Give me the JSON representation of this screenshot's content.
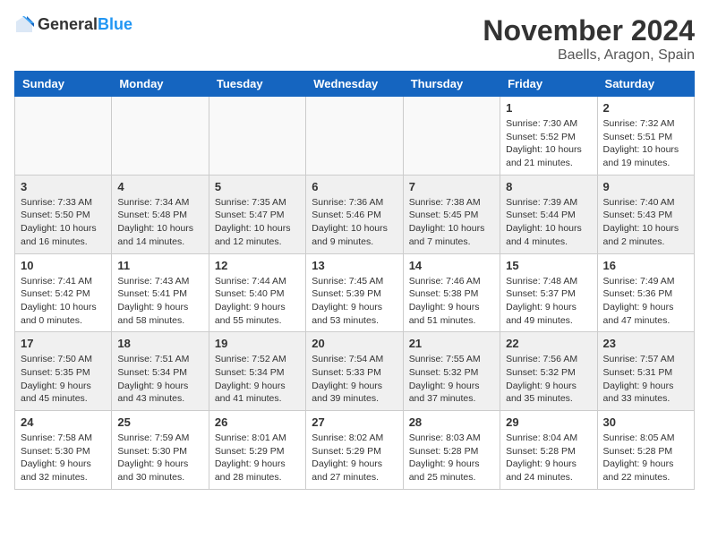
{
  "header": {
    "logo_general": "General",
    "logo_blue": "Blue",
    "month_title": "November 2024",
    "location": "Baells, Aragon, Spain"
  },
  "weekdays": [
    "Sunday",
    "Monday",
    "Tuesday",
    "Wednesday",
    "Thursday",
    "Friday",
    "Saturday"
  ],
  "weeks": [
    [
      {
        "day": "",
        "info": ""
      },
      {
        "day": "",
        "info": ""
      },
      {
        "day": "",
        "info": ""
      },
      {
        "day": "",
        "info": ""
      },
      {
        "day": "",
        "info": ""
      },
      {
        "day": "1",
        "info": "Sunrise: 7:30 AM\nSunset: 5:52 PM\nDaylight: 10 hours and 21 minutes."
      },
      {
        "day": "2",
        "info": "Sunrise: 7:32 AM\nSunset: 5:51 PM\nDaylight: 10 hours and 19 minutes."
      }
    ],
    [
      {
        "day": "3",
        "info": "Sunrise: 7:33 AM\nSunset: 5:50 PM\nDaylight: 10 hours and 16 minutes."
      },
      {
        "day": "4",
        "info": "Sunrise: 7:34 AM\nSunset: 5:48 PM\nDaylight: 10 hours and 14 minutes."
      },
      {
        "day": "5",
        "info": "Sunrise: 7:35 AM\nSunset: 5:47 PM\nDaylight: 10 hours and 12 minutes."
      },
      {
        "day": "6",
        "info": "Sunrise: 7:36 AM\nSunset: 5:46 PM\nDaylight: 10 hours and 9 minutes."
      },
      {
        "day": "7",
        "info": "Sunrise: 7:38 AM\nSunset: 5:45 PM\nDaylight: 10 hours and 7 minutes."
      },
      {
        "day": "8",
        "info": "Sunrise: 7:39 AM\nSunset: 5:44 PM\nDaylight: 10 hours and 4 minutes."
      },
      {
        "day": "9",
        "info": "Sunrise: 7:40 AM\nSunset: 5:43 PM\nDaylight: 10 hours and 2 minutes."
      }
    ],
    [
      {
        "day": "10",
        "info": "Sunrise: 7:41 AM\nSunset: 5:42 PM\nDaylight: 10 hours and 0 minutes."
      },
      {
        "day": "11",
        "info": "Sunrise: 7:43 AM\nSunset: 5:41 PM\nDaylight: 9 hours and 58 minutes."
      },
      {
        "day": "12",
        "info": "Sunrise: 7:44 AM\nSunset: 5:40 PM\nDaylight: 9 hours and 55 minutes."
      },
      {
        "day": "13",
        "info": "Sunrise: 7:45 AM\nSunset: 5:39 PM\nDaylight: 9 hours and 53 minutes."
      },
      {
        "day": "14",
        "info": "Sunrise: 7:46 AM\nSunset: 5:38 PM\nDaylight: 9 hours and 51 minutes."
      },
      {
        "day": "15",
        "info": "Sunrise: 7:48 AM\nSunset: 5:37 PM\nDaylight: 9 hours and 49 minutes."
      },
      {
        "day": "16",
        "info": "Sunrise: 7:49 AM\nSunset: 5:36 PM\nDaylight: 9 hours and 47 minutes."
      }
    ],
    [
      {
        "day": "17",
        "info": "Sunrise: 7:50 AM\nSunset: 5:35 PM\nDaylight: 9 hours and 45 minutes."
      },
      {
        "day": "18",
        "info": "Sunrise: 7:51 AM\nSunset: 5:34 PM\nDaylight: 9 hours and 43 minutes."
      },
      {
        "day": "19",
        "info": "Sunrise: 7:52 AM\nSunset: 5:34 PM\nDaylight: 9 hours and 41 minutes."
      },
      {
        "day": "20",
        "info": "Sunrise: 7:54 AM\nSunset: 5:33 PM\nDaylight: 9 hours and 39 minutes."
      },
      {
        "day": "21",
        "info": "Sunrise: 7:55 AM\nSunset: 5:32 PM\nDaylight: 9 hours and 37 minutes."
      },
      {
        "day": "22",
        "info": "Sunrise: 7:56 AM\nSunset: 5:32 PM\nDaylight: 9 hours and 35 minutes."
      },
      {
        "day": "23",
        "info": "Sunrise: 7:57 AM\nSunset: 5:31 PM\nDaylight: 9 hours and 33 minutes."
      }
    ],
    [
      {
        "day": "24",
        "info": "Sunrise: 7:58 AM\nSunset: 5:30 PM\nDaylight: 9 hours and 32 minutes."
      },
      {
        "day": "25",
        "info": "Sunrise: 7:59 AM\nSunset: 5:30 PM\nDaylight: 9 hours and 30 minutes."
      },
      {
        "day": "26",
        "info": "Sunrise: 8:01 AM\nSunset: 5:29 PM\nDaylight: 9 hours and 28 minutes."
      },
      {
        "day": "27",
        "info": "Sunrise: 8:02 AM\nSunset: 5:29 PM\nDaylight: 9 hours and 27 minutes."
      },
      {
        "day": "28",
        "info": "Sunrise: 8:03 AM\nSunset: 5:28 PM\nDaylight: 9 hours and 25 minutes."
      },
      {
        "day": "29",
        "info": "Sunrise: 8:04 AM\nSunset: 5:28 PM\nDaylight: 9 hours and 24 minutes."
      },
      {
        "day": "30",
        "info": "Sunrise: 8:05 AM\nSunset: 5:28 PM\nDaylight: 9 hours and 22 minutes."
      }
    ]
  ]
}
